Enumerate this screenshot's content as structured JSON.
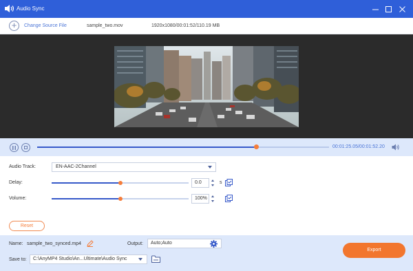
{
  "window": {
    "title": "Audio Sync",
    "icons": {
      "app": "audio-sync-icon",
      "minimize": "minimize-icon",
      "maximize": "maximize-icon",
      "close": "close-icon"
    }
  },
  "filebar": {
    "change_source": "Change Source File",
    "file_name": "sample_two.mov",
    "file_meta": "1920x1080/00:01:52/110.19 MB"
  },
  "player": {
    "timecode": "00:01:25.05/00:01:52.20",
    "progress": 0.75,
    "icons": {
      "pause": "pause-icon",
      "stop": "stop-icon",
      "volume": "volume-icon"
    }
  },
  "settings": {
    "audio_track_label": "Audio Track:",
    "audio_track_value": "EN-AAC-2Channel",
    "delay_label": "Delay:",
    "delay_value": "0.0",
    "delay_unit": "s",
    "delay_slider": 0.5,
    "volume_label": "Volume:",
    "volume_value": "100%",
    "volume_slider": 0.5,
    "reset_label": "Reset"
  },
  "output": {
    "name_label": "Name:",
    "name_value": "sample_two_synced.mp4",
    "output_label": "Output:",
    "output_value": "Auto;Auto",
    "save_to_label": "Save to:",
    "save_to_value": "C:\\AnyMP4 Studio\\An...Ultimate\\Audio Sync",
    "export_label": "Export"
  },
  "colors": {
    "titlebar": "#2f5fd9",
    "accent_blue": "#3558c9",
    "accent_orange": "#f57d3a",
    "panel": "#dde8fb",
    "preview_bg": "#2b2b2b"
  }
}
